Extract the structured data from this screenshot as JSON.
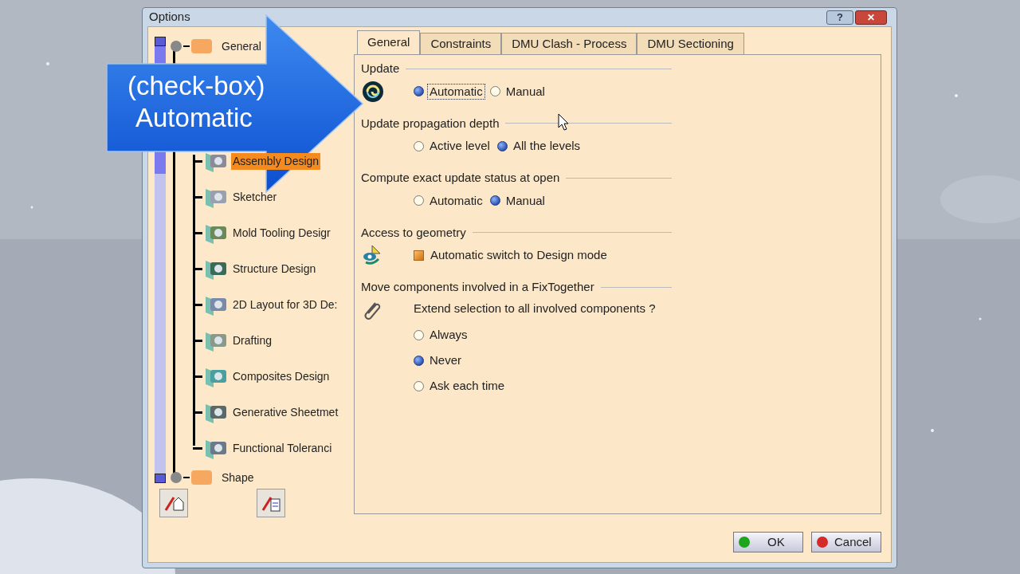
{
  "window": {
    "title": "Options",
    "help_button": "?",
    "close_button": "✕"
  },
  "tree": [
    {
      "kind": "node",
      "label": "General",
      "selected": false
    },
    {
      "kind": "gap"
    },
    {
      "kind": "leaf",
      "label": "Assembly Design",
      "selected": true
    },
    {
      "kind": "leaf",
      "label": "Sketcher",
      "selected": false
    },
    {
      "kind": "leaf",
      "label": "Mold Tooling Desigr",
      "selected": false
    },
    {
      "kind": "leaf",
      "label": "Structure Design",
      "selected": false
    },
    {
      "kind": "leaf",
      "label": "2D Layout for 3D De:",
      "selected": false
    },
    {
      "kind": "leaf",
      "label": "Drafting",
      "selected": false
    },
    {
      "kind": "leaf",
      "label": "Composites Design",
      "selected": false
    },
    {
      "kind": "leaf",
      "label": "Generative Sheetmet",
      "selected": false
    },
    {
      "kind": "leaf",
      "label": "Functional Toleranci",
      "selected": false
    },
    {
      "kind": "node",
      "label": "Shape",
      "selected": false
    }
  ],
  "tabs": [
    {
      "label": "General",
      "selected": true
    },
    {
      "label": "Constraints",
      "selected": false
    },
    {
      "label": "DMU Clash - Process",
      "selected": false
    },
    {
      "label": "DMU Sectioning",
      "selected": false
    }
  ],
  "sections": [
    {
      "kind": "radio",
      "title": "Update",
      "options": [
        {
          "label": "Automatic",
          "selected": true,
          "focused": true
        },
        {
          "label": "Manual",
          "selected": false,
          "focused": false
        }
      ]
    },
    {
      "kind": "radio",
      "title": "Update propagation depth",
      "options": [
        {
          "label": "Active level",
          "selected": false,
          "focused": false
        },
        {
          "label": "All the levels",
          "selected": true,
          "focused": false
        }
      ]
    },
    {
      "kind": "radio",
      "title": "Compute exact update status at open",
      "options": [
        {
          "label": "Automatic",
          "selected": false,
          "focused": false
        },
        {
          "label": "Manual",
          "selected": true,
          "focused": false
        }
      ]
    },
    {
      "kind": "check",
      "title": "Access to geometry",
      "label": "Automatic switch to Design mode",
      "checked": true
    },
    {
      "kind": "stack",
      "title": "Move components involved in a FixTogether",
      "question": "Extend selection to all involved components ?",
      "options": [
        {
          "label": "Always",
          "selected": false,
          "focused": false
        },
        {
          "label": "Never",
          "selected": true,
          "focused": false
        },
        {
          "label": "Ask each time",
          "selected": false,
          "focused": false
        }
      ]
    }
  ],
  "buttons": [
    {
      "label": "OK",
      "kind": "ok"
    },
    {
      "label": "Cancel",
      "kind": "cancel"
    }
  ],
  "callout": {
    "lines": [
      "(check-box)",
      "Automatic"
    ]
  }
}
